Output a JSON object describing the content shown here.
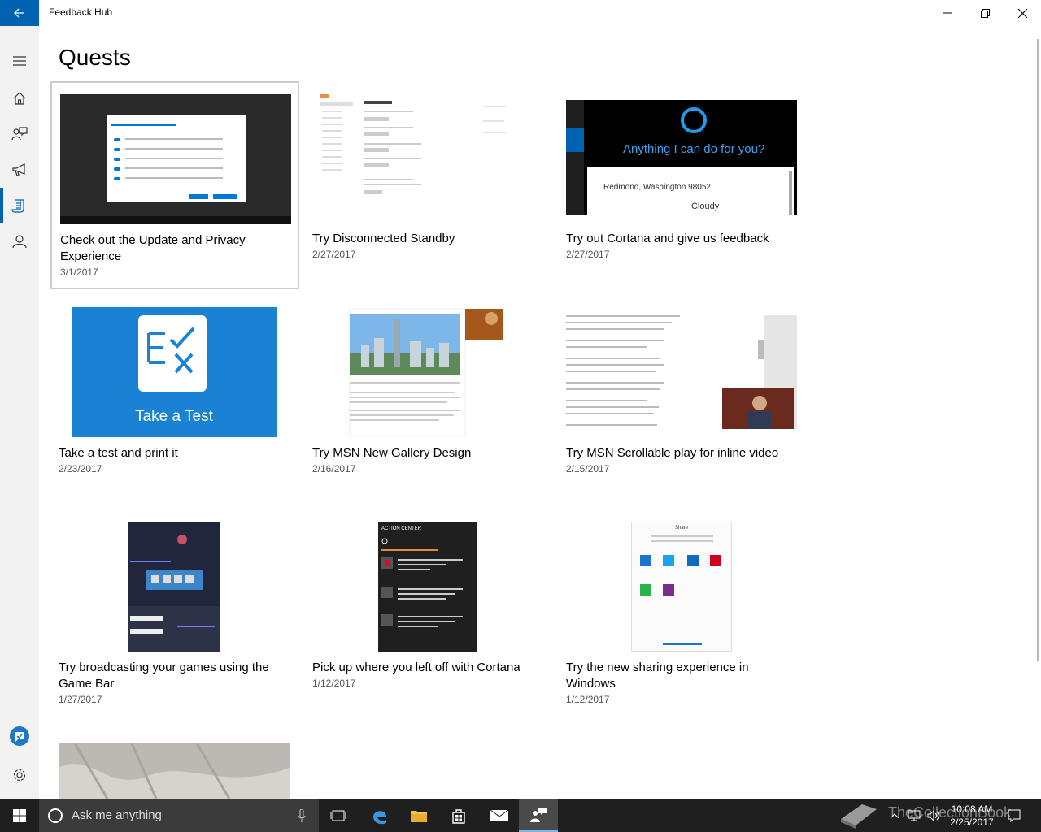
{
  "window": {
    "title": "Feedback Hub"
  },
  "page": {
    "title": "Quests"
  },
  "nav": {
    "items": [
      "menu-icon",
      "home-icon",
      "feedback-icon",
      "announcements-icon",
      "quests-icon",
      "profile-icon"
    ],
    "active": "quests"
  },
  "quests": [
    {
      "title": "Check out the Update and Privacy Experience",
      "date": "3/1/2017"
    },
    {
      "title": "Try Disconnected Standby",
      "date": "2/27/2017"
    },
    {
      "title": "Try out Cortana and give us feedback",
      "date": "2/27/2017"
    },
    {
      "title": "Take a test and print it",
      "date": "2/23/2017"
    },
    {
      "title": "Try MSN New Gallery Design",
      "date": "2/16/2017"
    },
    {
      "title": "Try MSN Scrollable play for inline video",
      "date": "2/15/2017"
    },
    {
      "title": "Try broadcasting your games using the Game Bar",
      "date": "1/27/2017"
    },
    {
      "title": "Pick up where you left off with Cortana",
      "date": "1/12/2017"
    },
    {
      "title": "Try the new sharing experience in Windows",
      "date": "1/12/2017"
    }
  ],
  "thumbs": {
    "cortana_prompt": "Anything I can do for you?",
    "cortana_location": "Redmond, Washington 98052",
    "cortana_weather": "Cloudy",
    "test_label": "Take a Test",
    "action_center": "ACTION CENTER",
    "share": "Share"
  },
  "taskbar": {
    "search_placeholder": "Ask me anything",
    "time": "10:08 AM",
    "date": "2/25/2017",
    "watermark": "TheCollectionBook"
  },
  "colors": {
    "accent": "#0063b1",
    "taskbar": "#1f1f1f",
    "rail": "#f2f2f2"
  }
}
